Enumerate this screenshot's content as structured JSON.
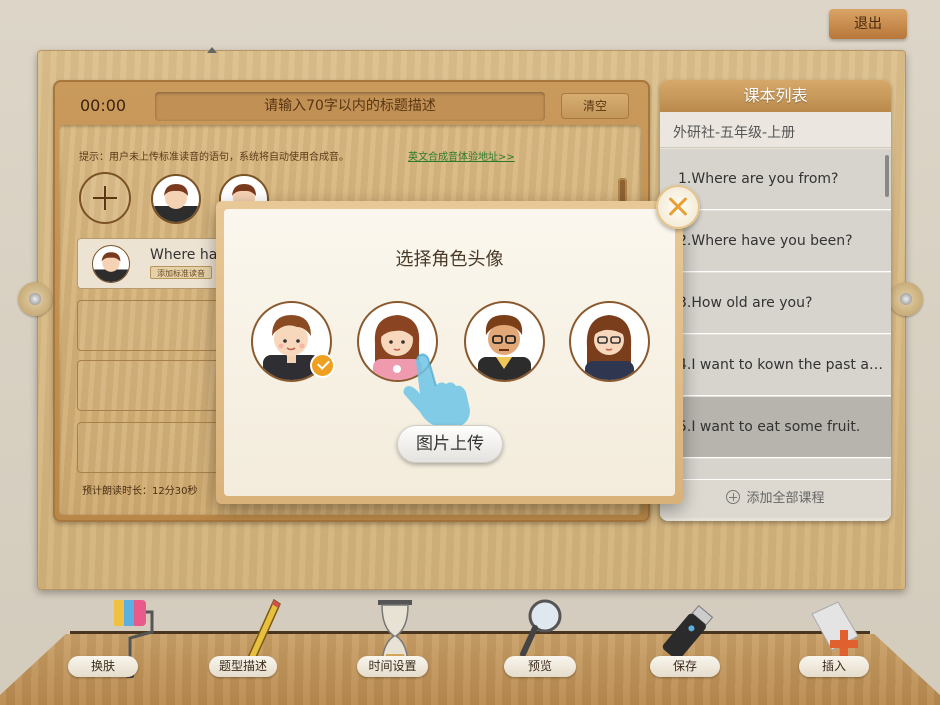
{
  "header": {
    "exit_label": "退出"
  },
  "editor": {
    "timer": "00:00",
    "title_placeholder": "请输入70字以内的标题描述",
    "clear_label": "清空",
    "hint": "提示：用户未上传标准读音的语句，系统将自动使用合成音。",
    "hint_link": "英文合成音体验地址>>",
    "rows": [
      {
        "text": "Where hav",
        "tag": "添加标准读音"
      }
    ],
    "estimate": "预计朗读时长：12分30秒"
  },
  "course_list": {
    "title": "课本列表",
    "selected_book": "外研社-五年级-上册",
    "items": [
      "1.Where are you from?",
      "2.Where have you been?",
      "3.How old are you?",
      "4.I want to kown the past and...",
      "5.I want to eat some fruit."
    ],
    "selected_index": 4,
    "footer_label": "添加全部课程"
  },
  "modal": {
    "title": "选择角色头像",
    "upload_label": "图片上传",
    "avatars": [
      "boy-avatar",
      "girl-avatar",
      "man-glasses-avatar",
      "woman-glasses-avatar"
    ],
    "selected_avatar": 0
  },
  "toolbar": {
    "items": [
      {
        "label": "换肤",
        "icon": "paint-roller-icon"
      },
      {
        "label": "题型描述",
        "icon": "pencil-icon"
      },
      {
        "label": "时间设置",
        "icon": "hourglass-icon"
      },
      {
        "label": "预览",
        "icon": "magnifier-icon"
      },
      {
        "label": "保存",
        "icon": "usb-drive-icon"
      },
      {
        "label": "插入",
        "icon": "insert-file-icon"
      }
    ]
  },
  "colors": {
    "accent": "#f0a020",
    "wood": "#d2b27a",
    "highlight_row": "#b7b4ae"
  }
}
